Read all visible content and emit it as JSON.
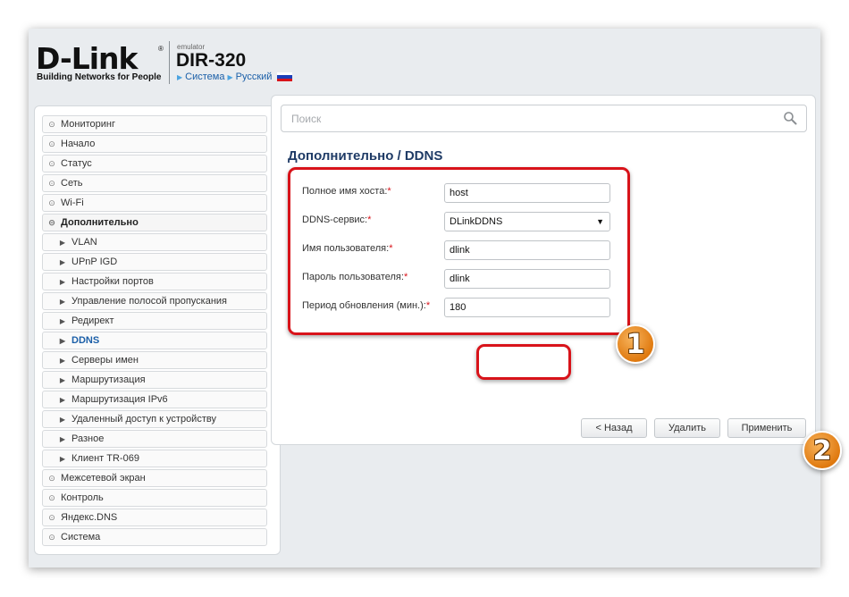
{
  "header": {
    "logo_text": "D-Link",
    "logo_registered": "®",
    "logo_tagline": "Building Networks for People",
    "emulator_label": "emulator",
    "model": "DIR-320",
    "breadcrumbs": [
      "Система",
      "Русский"
    ],
    "flag_colors": [
      "#ffffff",
      "#1c3fb8",
      "#d8131a"
    ]
  },
  "sidebar": {
    "items": [
      {
        "label": "Мониторинг",
        "level": "top",
        "icon": "circle-arrow-icon"
      },
      {
        "label": "Начало",
        "level": "top",
        "icon": "circle-arrow-icon"
      },
      {
        "label": "Статус",
        "level": "top",
        "icon": "circle-arrow-icon"
      },
      {
        "label": "Сеть",
        "level": "top",
        "icon": "circle-arrow-icon"
      },
      {
        "label": "Wi-Fi",
        "level": "top",
        "icon": "circle-arrow-icon"
      },
      {
        "label": "Дополнительно",
        "level": "top",
        "icon": "circle-chevron-down-icon",
        "expanded": true
      },
      {
        "label": "VLAN",
        "level": "sub",
        "icon": "triangle-right-icon"
      },
      {
        "label": "UPnP IGD",
        "level": "sub",
        "icon": "triangle-right-icon"
      },
      {
        "label": "Настройки портов",
        "level": "sub",
        "icon": "triangle-right-icon"
      },
      {
        "label": "Управление полосой пропускания",
        "level": "sub",
        "icon": "triangle-right-icon"
      },
      {
        "label": "Редирект",
        "level": "sub",
        "icon": "triangle-right-icon"
      },
      {
        "label": "DDNS",
        "level": "sub",
        "icon": "triangle-right-icon",
        "active": true
      },
      {
        "label": "Серверы имен",
        "level": "sub",
        "icon": "triangle-right-icon"
      },
      {
        "label": "Маршрутизация",
        "level": "sub",
        "icon": "triangle-right-icon"
      },
      {
        "label": "Маршрутизация IPv6",
        "level": "sub",
        "icon": "triangle-right-icon"
      },
      {
        "label": "Удаленный доступ к устройству",
        "level": "sub",
        "icon": "triangle-right-icon"
      },
      {
        "label": "Разное",
        "level": "sub",
        "icon": "triangle-right-icon"
      },
      {
        "label": "Клиент TR-069",
        "level": "sub",
        "icon": "triangle-right-icon"
      },
      {
        "label": "Межсетевой экран",
        "level": "top",
        "icon": "circle-arrow-icon"
      },
      {
        "label": "Контроль",
        "level": "top",
        "icon": "circle-arrow-icon"
      },
      {
        "label": "Яндекс.DNS",
        "level": "top",
        "icon": "circle-arrow-icon"
      },
      {
        "label": "Система",
        "level": "top",
        "icon": "circle-arrow-icon"
      }
    ]
  },
  "search": {
    "placeholder": "Поиск",
    "value": "",
    "icon": "magnifier-icon"
  },
  "main": {
    "title": "Дополнительно /  DDNS",
    "form": {
      "hostname_label": "Полное имя хоста:",
      "hostname_value": "host",
      "service_label": "DDNS-сервис:",
      "service_value": "DLinkDDNS",
      "username_label": "Имя пользователя:",
      "username_value": "dlink",
      "password_label": "Пароль пользователя:",
      "password_value": "dlink",
      "period_label": "Период обновления (мин.):",
      "period_value": "180",
      "required_mark": "*"
    },
    "buttons": {
      "back": "< Назад",
      "delete": "Удалить",
      "apply": "Применить"
    }
  },
  "annotations": {
    "badge_1": "1",
    "badge_2": "2",
    "highlight_color": "#d8131a",
    "badge_color": "#e07a10"
  }
}
